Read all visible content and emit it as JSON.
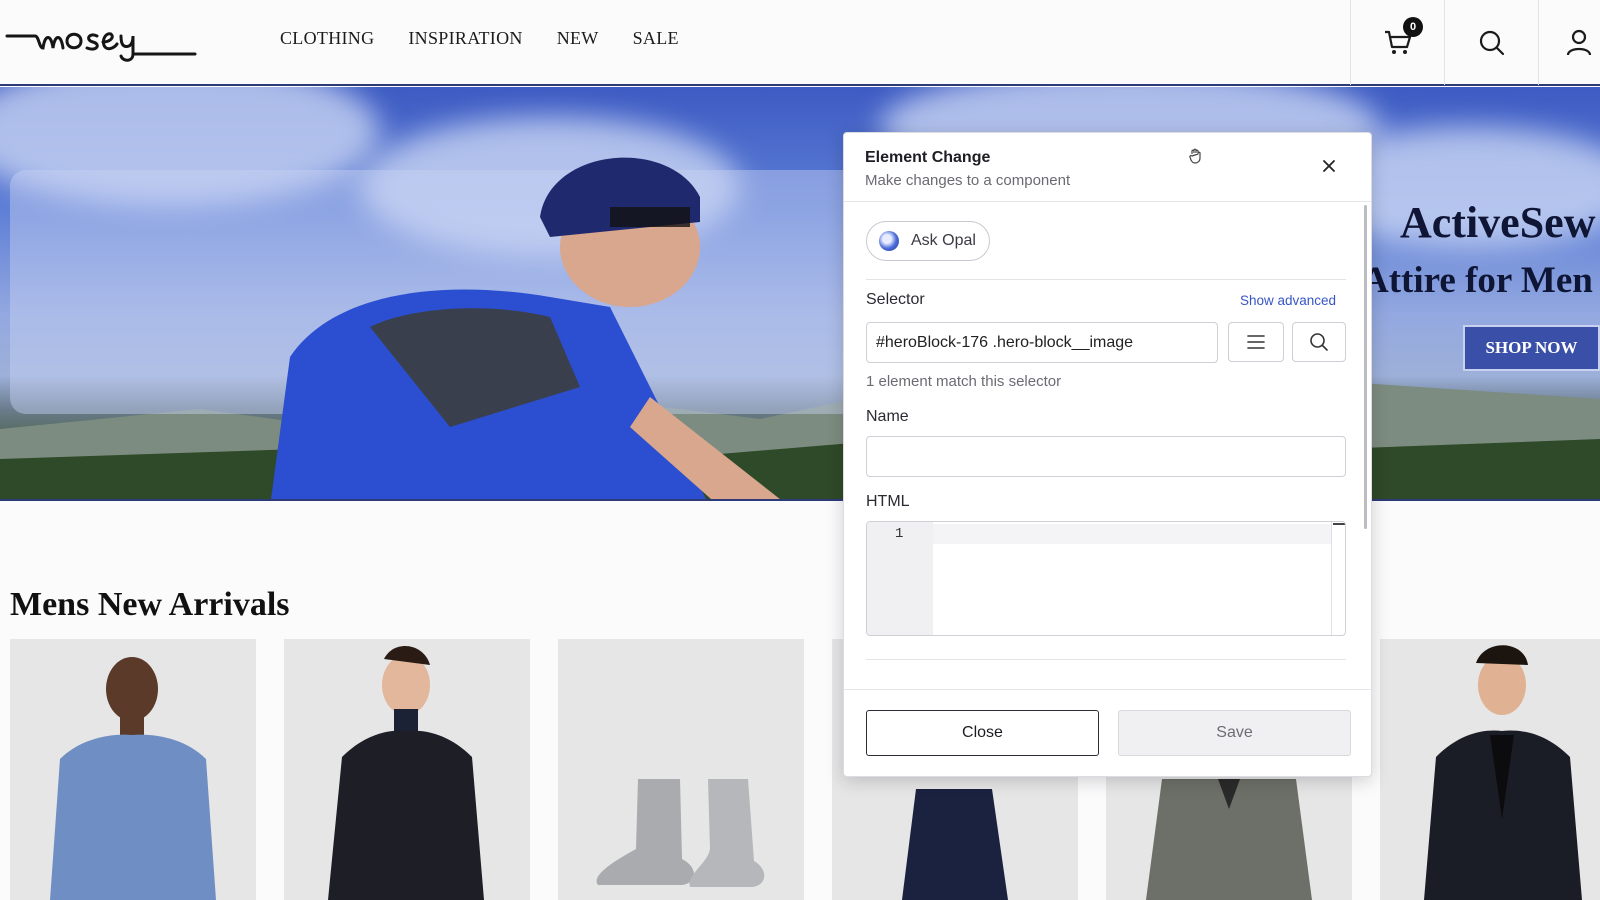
{
  "header": {
    "logo_text": "mosey",
    "nav": [
      "CLOTHING",
      "INSPIRATION",
      "NEW",
      "SALE"
    ],
    "cart_count": "0",
    "icons": [
      "cart-icon",
      "search-icon",
      "user-icon"
    ]
  },
  "hero": {
    "title": "ActiveSew",
    "subtitle": "Attire for Men",
    "cta": "SHOP NOW"
  },
  "products": {
    "section_title": "Mens New Arrivals",
    "items": [
      "blue-sweater",
      "black-coat",
      "grey-boots",
      "navy-coat",
      "grey-coat",
      "black-blazer"
    ]
  },
  "modal": {
    "title": "Element Change",
    "subtitle": "Make changes to a component",
    "ask_opal": "Ask Opal",
    "selector_label": "Selector",
    "show_advanced": "Show advanced",
    "selector_value": "#heroBlock-176 .hero-block__image",
    "match_hint": "1 element match this selector",
    "name_label": "Name",
    "name_value": "",
    "html_label": "HTML",
    "line_number": "1",
    "close_label": "Close",
    "save_label": "Save"
  },
  "colors": {
    "accent": "#3656c6",
    "hero_button": "#3a50a8",
    "header_border": "#2d3a78"
  }
}
